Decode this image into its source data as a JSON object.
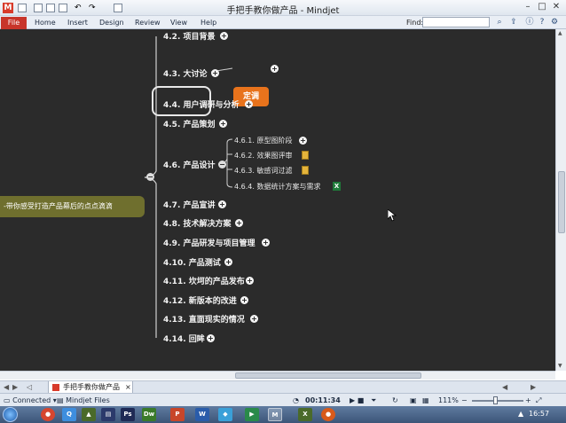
{
  "window": {
    "title": "手把手教你做产品 - Mindjet"
  },
  "ribbon": {
    "file": "File",
    "tabs": [
      "Home",
      "Insert",
      "Design",
      "Review",
      "View",
      "Help"
    ],
    "find_label": "Find:",
    "find_value": ""
  },
  "map": {
    "root_label": "-带你感受打造产品幕后的点点滴滴",
    "topics": [
      {
        "label": "4.2. 项目背景"
      },
      {
        "label": "4.3. 大讨论"
      },
      {
        "label": "4.4. 用户调研与分析"
      },
      {
        "label": "4.5. 产品策划"
      },
      {
        "label": "4.6. 产品设计"
      },
      {
        "label": "4.7. 产品宣讲"
      },
      {
        "label": "4.8. 技术解决方案"
      },
      {
        "label": "4.9. 产品研发与项目管理"
      },
      {
        "label": "4.10. 产品测试"
      },
      {
        "label": "4.11. 坎坷的产品发布"
      },
      {
        "label": "4.12. 新版本的改进"
      },
      {
        "label": "4.13. 直面现实的情况"
      },
      {
        "label": "4.14. 回眸"
      }
    ],
    "callout": "定调",
    "subtopics": [
      {
        "label": "4.6.1. 原型图阶段"
      },
      {
        "label": "4.6.2. 效果图评审"
      },
      {
        "label": "4.6.3. 敏感词过滤"
      },
      {
        "label": "4.6.4. 数据统计方案与需求"
      }
    ]
  },
  "doc_tab": {
    "label": "手把手教你做产品"
  },
  "status": {
    "connected": "Connected",
    "files": "Mindjet Files",
    "timer": "00:11:34",
    "zoom": "111%"
  },
  "taskbar": {
    "clock": "16:57"
  },
  "colors": {
    "canvas": "#2b2b2b",
    "root": "#6f6f2e",
    "callout": "#e8731c",
    "file_tab": "#c8352a"
  }
}
